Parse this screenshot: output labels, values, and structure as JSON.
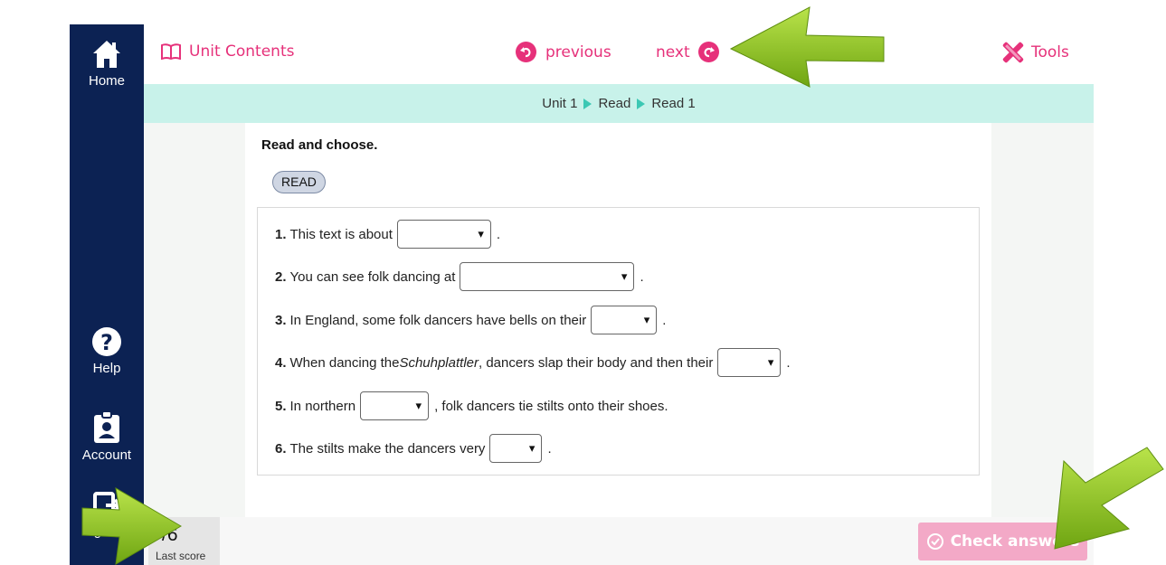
{
  "sidebar": {
    "home_label": "Home",
    "help_label": "Help",
    "account_label": "Account",
    "signout_label": "Sign out"
  },
  "topbar": {
    "unit_contents": "Unit Contents",
    "previous": "previous",
    "next": "next",
    "tools": "Tools"
  },
  "breadcrumb": [
    "Unit 1",
    "Read",
    "Read 1"
  ],
  "exercise": {
    "instruction": "Read and choose.",
    "read_button": "READ",
    "questions": [
      {
        "num": "1.",
        "before": "This text is about",
        "after": "."
      },
      {
        "num": "2.",
        "before": "You can see folk dancing at",
        "after": "."
      },
      {
        "num": "3.",
        "before": "In England, some folk dancers have bells on their",
        "after": "."
      },
      {
        "num": "4.",
        "before": "When dancing the ",
        "italic": "Schuhplattler",
        "mid": ", dancers slap their body and then their",
        "after": "."
      },
      {
        "num": "5.",
        "before": "In northern",
        "after": ", folk dancers tie stilts onto their shoes."
      },
      {
        "num": "6.",
        "before": "The stilts make the dancers very",
        "after": "."
      }
    ]
  },
  "score": {
    "value": "-/6",
    "label": "Last score"
  },
  "check_answers": "Check answers",
  "colors": {
    "accent": "#e6317a",
    "sidebar": "#0c2253",
    "breadcrumb_bg": "#c8f2ea",
    "arrow": "#8cc21a"
  }
}
